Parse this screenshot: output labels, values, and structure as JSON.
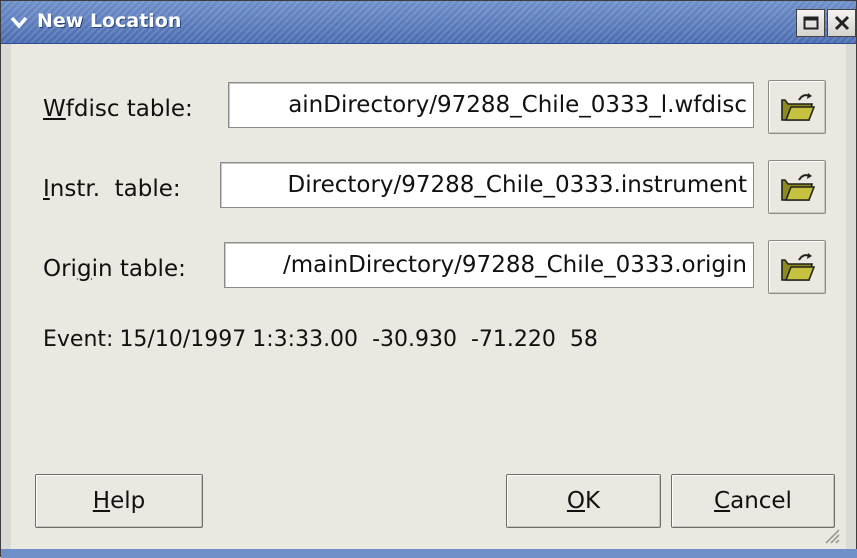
{
  "window": {
    "title": "New Location",
    "menu_icon": "chevron-down-icon",
    "maximize_icon": "maximize-icon",
    "close_icon": "close-icon"
  },
  "fields": [
    {
      "label": "Wfdisc table:",
      "value": "ainDirectory/97288_Chile_0333_l.wfdisc",
      "button_icon": "open-folder-icon"
    },
    {
      "label": "Instr.  table:",
      "value": "Directory/97288_Chile_0333.instrument",
      "button_icon": "open-folder-icon"
    },
    {
      "label": "Origin table:",
      "value": "/mainDirectory/97288_Chile_0333.origin",
      "button_icon": "open-folder-icon"
    }
  ],
  "event": {
    "label": "Event:",
    "date": "15/10/1997",
    "time": "1:3:33.00",
    "lat": "-30.930",
    "lon": "-71.220",
    "depth": "58"
  },
  "buttons": {
    "help": "Help",
    "ok": "OK",
    "cancel": "Cancel"
  },
  "colors": {
    "titlebar": "#4c6cb1",
    "dialog_bg": "#ebe8e2"
  }
}
